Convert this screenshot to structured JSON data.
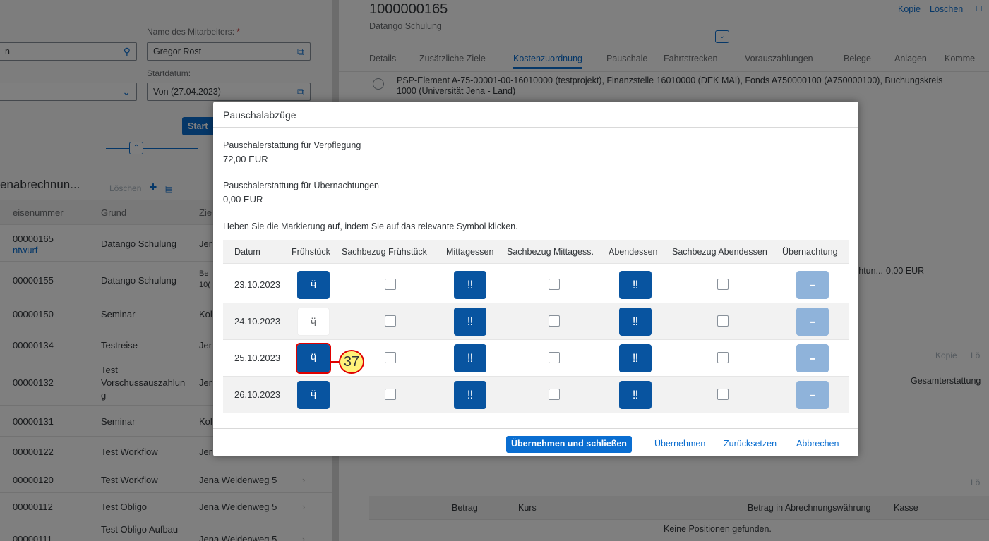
{
  "left": {
    "employee_label": "Name des Mitarbeiters:",
    "employee_required": "*",
    "employee_value": "Gregor Rost",
    "search_value": "n",
    "start_label": "Startdatum:",
    "start_value": "Von (27.04.2023)",
    "start_button": "Start",
    "table_title": "enabrechnun...",
    "delete_label": "Löschen",
    "headers": [
      "eisenummer",
      "Grund",
      "Zie"
    ],
    "rows": [
      {
        "id": "00000165",
        "status": "ntwurf",
        "reason": "Datango Schulung",
        "dest": "Jer"
      },
      {
        "id": "00000155",
        "reason": "Datango Schulung",
        "dest": "Be",
        "dest2": "10("
      },
      {
        "id": "00000150",
        "reason": "Seminar",
        "dest": "Kol"
      },
      {
        "id": "00000134",
        "reason": "Testreise",
        "dest": "Jer"
      },
      {
        "id": "00000132",
        "reason": "Test",
        "reason2": "Vorschussauszahlun",
        "reason3": "g",
        "dest": "Jer"
      },
      {
        "id": "00000131",
        "reason": "Seminar",
        "dest": "Kol"
      },
      {
        "id": "00000122",
        "reason": "Test Workflow",
        "dest": "Jer"
      },
      {
        "id": "00000120",
        "reason": "Test Workflow",
        "dest": "Jena Weidenweg 5"
      },
      {
        "id": "00000112",
        "reason": "Test Obligo",
        "dest": "Jena Weidenweg 5"
      },
      {
        "id": "00000111",
        "reason": "Test Obligo Aufbau",
        "dest": "Jena Weidenweg 5"
      }
    ]
  },
  "right": {
    "trip_number": "1000000165",
    "trip_subtitle": "Datango Schulung",
    "copy_label": "Kopie",
    "delete_label": "Löschen",
    "tabs": [
      "Details",
      "Zusätzliche Ziele",
      "Kostenzuordnung",
      "Pauschale",
      "Fahrtstrecken",
      "Vorauszahlungen",
      "Belege",
      "Anlagen",
      "Komme"
    ],
    "cost_line1": "PSP-Element A-75-00001-00-16010000 (testprojekt), Finanzstelle 16010000 (DEK MAI), Fonds A750000100 (A750000100), Buchungskreis",
    "cost_line2": "1000 (Universität Jena - Land)",
    "side_text": "chtun...",
    "side_value": "0,00 EUR",
    "copy2": "Kopie",
    "copy2b": "Lö",
    "total_header": "Gesamterstattung",
    "lo2": "Lö",
    "bottom_headers": [
      "Betrag",
      "Kurs",
      "Betrag in Abrechnungswährung",
      "Kasse"
    ],
    "no_items": "Keine Positionen gefunden."
  },
  "dialog": {
    "title": "Pauschalabzüge",
    "meal_label": "Pauschalerstattung für Verpflegung",
    "meal_value": "72,00 EUR",
    "night_label": "Pauschalerstattung für Übernachtungen",
    "night_value": "0,00 EUR",
    "instruction": "Heben Sie die Markierung auf, indem Sie auf das relevante Symbol klicken.",
    "columns": [
      "Datum",
      "Frühstück",
      "Sachbezug Frühstück",
      "Mittagessen",
      "Sachbezug Mittagess.",
      "Abendessen",
      "Sachbezug Abendessen",
      "Übernachtung"
    ],
    "rows": [
      {
        "date": "23.10.2023",
        "breakfast": true,
        "lunch": true,
        "dinner": true
      },
      {
        "date": "24.10.2023",
        "breakfast": false,
        "lunch": true,
        "dinner": true
      },
      {
        "date": "25.10.2023",
        "breakfast": true,
        "lunch": true,
        "dinner": true
      },
      {
        "date": "26.10.2023",
        "breakfast": true,
        "lunch": true,
        "dinner": true
      }
    ],
    "step_marker": "37",
    "buttons": {
      "apply_close": "Übernehmen und schließen",
      "apply": "Übernehmen",
      "reset": "Zurücksetzen",
      "cancel": "Abbrechen"
    },
    "icons": {
      "breakfast": "apple-icon",
      "lunch": "cutlery-icon",
      "dinner": "cutlery-icon",
      "overnight": "bed-icon"
    },
    "colors": {
      "tile_active": "#0854a0",
      "tile_disabled": "#8fb3da",
      "accent": "#0a6ed1",
      "marker": "#fff27a"
    }
  }
}
